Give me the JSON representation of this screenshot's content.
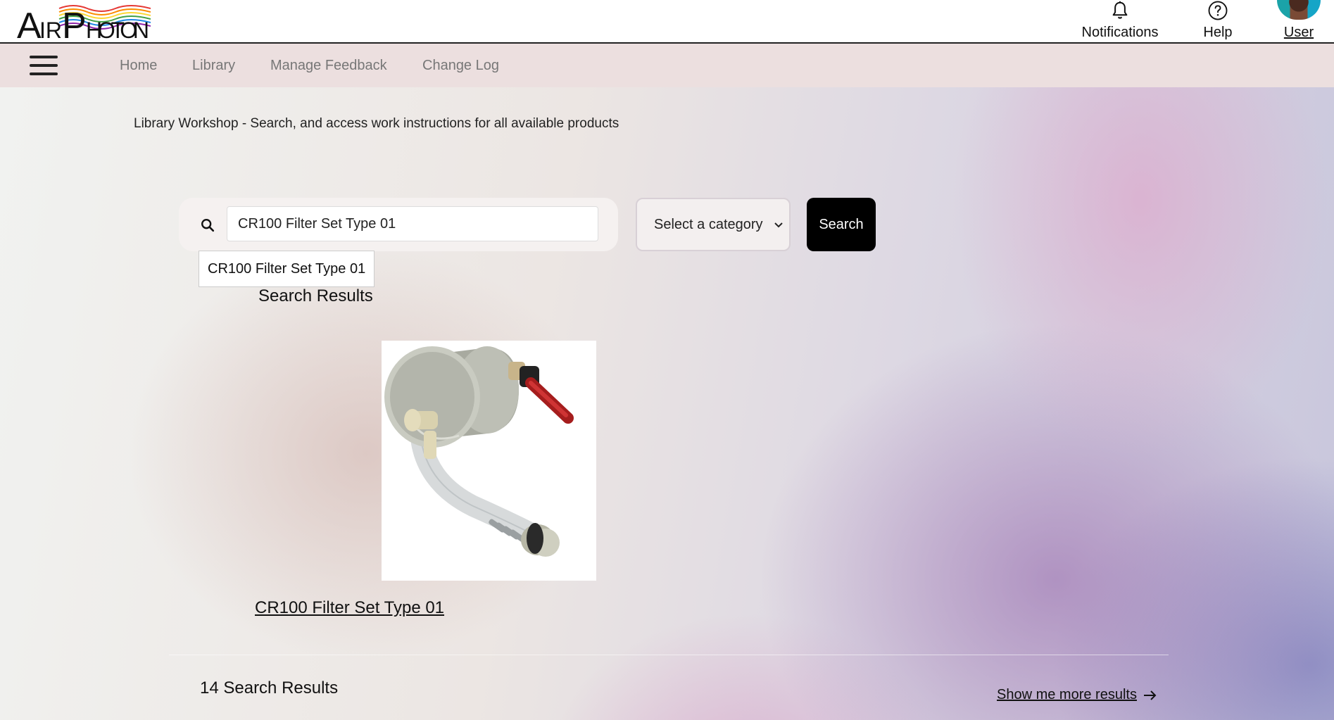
{
  "app": {
    "logo_text": "AIRPHOTON"
  },
  "header": {
    "notifications_label": "Notifications",
    "help_label": "Help",
    "user_label": "User"
  },
  "nav": {
    "items": [
      {
        "label": "Home"
      },
      {
        "label": "Library"
      },
      {
        "label": "Manage Feedback"
      },
      {
        "label": "Change Log"
      }
    ]
  },
  "page": {
    "tagline": "Library Workshop - Search, and access work instructions for all available products"
  },
  "search": {
    "value": "CR100 Filter Set Type 01",
    "suggestion": "CR100 Filter Set Type 01",
    "category_placeholder": "Select a category",
    "button_label": "Search"
  },
  "results": {
    "heading": "Search Results",
    "items": [
      {
        "title": "CR100 Filter Set Type 01",
        "image": "filter-set-3d-render"
      }
    ],
    "count_text": "14 Search Results",
    "more_link": "Show me more results"
  },
  "icons": {
    "bell": "bell-icon",
    "help": "help-icon",
    "search": "search-icon",
    "menu": "hamburger-menu-icon",
    "arrow": "arrow-right-icon"
  },
  "colors": {
    "nav_bg": "#ecdfdf",
    "button_bg": "#000000",
    "logo_waves": [
      "#e53935",
      "#fb8c00",
      "#fdd835",
      "#43a047",
      "#1e88e5",
      "#8e24aa"
    ]
  }
}
